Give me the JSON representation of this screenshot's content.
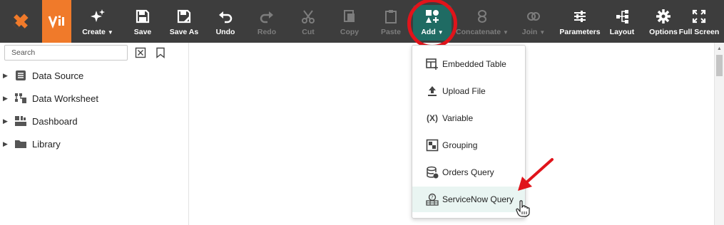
{
  "toolbar": {
    "create": "Create",
    "save": "Save",
    "save_as": "Save As",
    "undo": "Undo",
    "redo": "Redo",
    "cut": "Cut",
    "copy": "Copy",
    "paste": "Paste",
    "add": "Add",
    "concatenate": "Concatenate",
    "join": "Join",
    "parameters": "Parameters",
    "layout": "Layout",
    "options": "Options",
    "full_screen": "Full Screen"
  },
  "sidebar": {
    "search_placeholder": "Search",
    "items": [
      {
        "label": "Data Source",
        "icon": "data-source-icon"
      },
      {
        "label": "Data Worksheet",
        "icon": "worksheet-icon"
      },
      {
        "label": "Dashboard",
        "icon": "dashboard-icon"
      },
      {
        "label": "Library",
        "icon": "folder-icon"
      }
    ]
  },
  "add_menu": {
    "items": [
      {
        "label": "Embedded Table",
        "icon": "embedded-table-icon"
      },
      {
        "label": "Upload File",
        "icon": "upload-icon"
      },
      {
        "label": "Variable",
        "icon": "variable-icon"
      },
      {
        "label": "Grouping",
        "icon": "grouping-icon"
      },
      {
        "label": "Orders Query",
        "icon": "database-query-icon"
      },
      {
        "label": "ServiceNow Query",
        "icon": "servicenow-query-icon"
      }
    ],
    "highlighted": "ServiceNow Query"
  },
  "colors": {
    "toolbar_bg": "#3d3d3d",
    "brand_orange": "#f07a2a",
    "add_active": "#1f6b63",
    "annotation_red": "#e0141b",
    "menu_hover": "#e9f5f2"
  }
}
